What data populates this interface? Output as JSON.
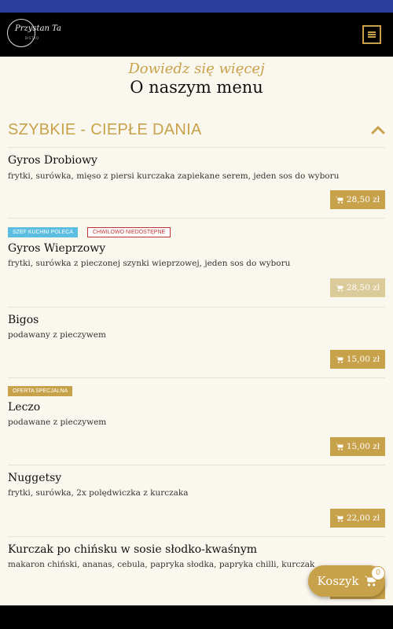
{
  "header": {
    "logo_text": "Przystan Ta",
    "logo_sub": "BISTRO"
  },
  "hero": {
    "script": "Dowiedz się więcej",
    "title": "O naszym menu"
  },
  "section": {
    "title": "SZYBKIE - CIEPŁE DANIA",
    "collapse_icon": "chevron-up-icon"
  },
  "items": [
    {
      "name": "Gyros Drobiowy",
      "desc": "frytki, surówka, mięso z piersi kurczaka zapiekane serem, jeden sos do wyboru",
      "price": "28,50 zł",
      "available": true,
      "badges": []
    },
    {
      "name": "Gyros Wieprzowy",
      "desc": "frytki, surówka z pieczonej szynki wieprzowej, jeden sos do wyboru",
      "price": "28,50 zł",
      "available": false,
      "badges": [
        "SZEF KUCHNI POLECA",
        "CHWILOWO NIEDOSTĘPNE"
      ]
    },
    {
      "name": "Bigos",
      "desc": "podawany z pieczywem",
      "price": "15,00 zł",
      "available": true,
      "badges": []
    },
    {
      "name": "Leczo",
      "desc": "podawane z pieczywem",
      "price": "15,00 zł",
      "available": true,
      "badges": [
        "OFERTA SPECJALNA"
      ]
    },
    {
      "name": "Nuggetsy",
      "desc": "frytki, surówka, 2x polędwiczka z kurczaka",
      "price": "22,00 zł",
      "available": true,
      "badges": []
    },
    {
      "name": "Kurczak po chińsku w sosie słodko-kwaśnym",
      "desc": "makaron chiński, ananas, cebula, papryka słodka, papryka chilli, kurczak",
      "price": "",
      "available": true,
      "badges": []
    }
  ],
  "cart": {
    "label": "Koszyk",
    "count": "0"
  },
  "colors": {
    "accent": "#c8a24a",
    "top_strip": "#2b3e9c",
    "header_bg": "#000000",
    "page_bg": "#faf7ef",
    "badge_blue": "#5bbde0",
    "badge_red": "#b33333"
  }
}
